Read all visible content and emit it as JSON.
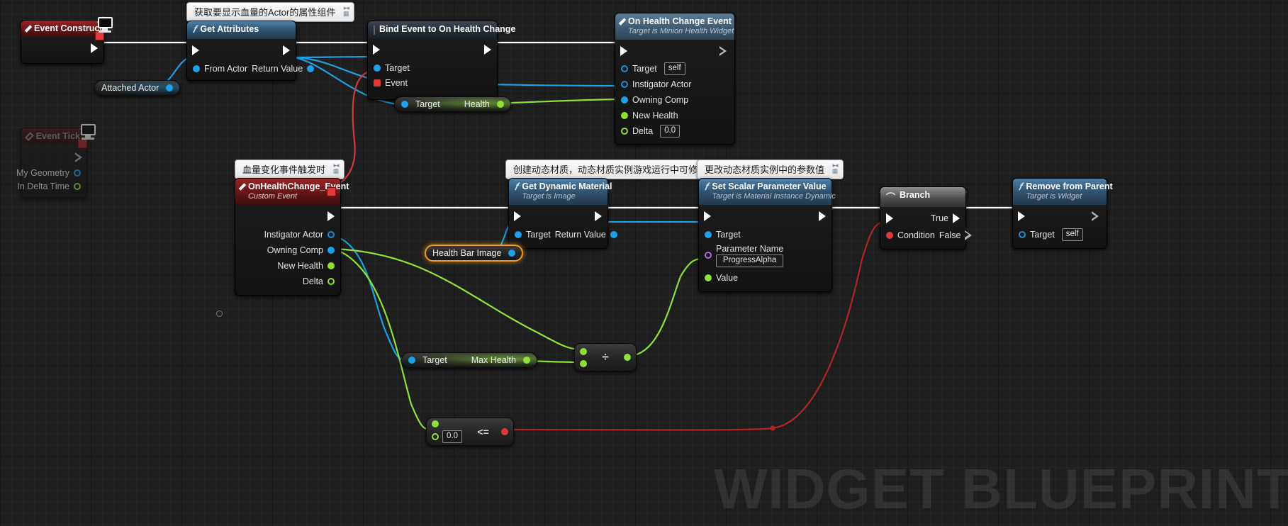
{
  "app": {
    "watermark": "WIDGET BLUEPRINT"
  },
  "comments": [
    {
      "id": "c1",
      "text": "获取要显示血量的Actor的属性组件"
    },
    {
      "id": "c2",
      "text": "血量变化事件触发时"
    },
    {
      "id": "c3",
      "text": "创建动态材质，动态材质实例游戏运行中可修改材质参数"
    },
    {
      "id": "c4",
      "text": "更改动态材质实例中的参数值"
    }
  ],
  "nodes": {
    "event_construct": {
      "title": "Event Construct",
      "icon": "event-diamond-icon",
      "device_icon": "monitor-icon"
    },
    "event_tick": {
      "title": "Event Tick",
      "icon": "event-diamond-icon",
      "device_icon": "monitor-icon",
      "outputs": [
        {
          "label": "My Geometry",
          "type": "struct"
        },
        {
          "label": "In Delta Time",
          "type": "float"
        }
      ]
    },
    "get_attributes": {
      "title": "Get Attributes",
      "icon": "function-f-icon",
      "input_pin": "From Actor",
      "output_pin": "Return Value"
    },
    "attached_actor": {
      "label": "Attached Actor"
    },
    "bind_event": {
      "title": "Bind Event to On Health Change",
      "icon": "bind-box-icon",
      "inputs": [
        {
          "label": "Target",
          "type": "object"
        },
        {
          "label": "Event",
          "type": "delegate"
        }
      ]
    },
    "get_health": {
      "input_label": "Target",
      "output_label": "Health"
    },
    "on_health_change_event": {
      "title": "On Health Change Event",
      "subtitle": "Target is Minion Health Widget",
      "icon": "event-diamond-icon",
      "inputs": [
        {
          "label": "Target",
          "value": "self",
          "type": "object"
        },
        {
          "label": "Instigator Actor",
          "value": "",
          "type": "object"
        },
        {
          "label": "Owning Comp",
          "value": "",
          "type": "object"
        },
        {
          "label": "New Health",
          "value": "",
          "type": "float"
        },
        {
          "label": "Delta",
          "value": "0.0",
          "type": "float"
        }
      ]
    },
    "custom_event": {
      "title": "OnHealthChange_Event",
      "subtitle": "Custom Event",
      "icon": "event-diamond-icon",
      "outputs": [
        {
          "label": "Instigator Actor",
          "type": "object"
        },
        {
          "label": "Owning Comp",
          "type": "object"
        },
        {
          "label": "New Health",
          "type": "float"
        },
        {
          "label": "Delta",
          "type": "float"
        }
      ]
    },
    "get_dynamic_material": {
      "title": "Get Dynamic Material",
      "subtitle": "Target is Image",
      "icon": "function-f-icon",
      "input_pin": "Target",
      "output_pin": "Return Value"
    },
    "health_bar_image": {
      "label": "Health Bar Image",
      "selected": true
    },
    "set_scalar_parameter_value": {
      "title": "Set Scalar Parameter Value",
      "subtitle": "Target is Material Instance Dynamic",
      "icon": "function-f-icon",
      "inputs": [
        {
          "label": "Target",
          "type": "object"
        },
        {
          "label": "Parameter Name",
          "value": "ProgressAlpha",
          "type": "name"
        },
        {
          "label": "Value",
          "type": "float"
        }
      ]
    },
    "branch": {
      "title": "Branch",
      "icon": "branch-icon",
      "input_label": "Condition",
      "outputs": [
        {
          "label": "True"
        },
        {
          "label": "False"
        }
      ]
    },
    "remove_from_parent": {
      "title": "Remove from Parent",
      "subtitle": "Target is Widget",
      "icon": "function-f-icon",
      "input_pin": "Target",
      "input_value": "self"
    },
    "get_max_health": {
      "input_label": "Target",
      "output_label": "Max Health"
    },
    "divide": {
      "operator": "÷",
      "type": "math-divide"
    },
    "less_equal": {
      "operator": "<=",
      "value": "0.0",
      "type": "math-compare"
    }
  }
}
